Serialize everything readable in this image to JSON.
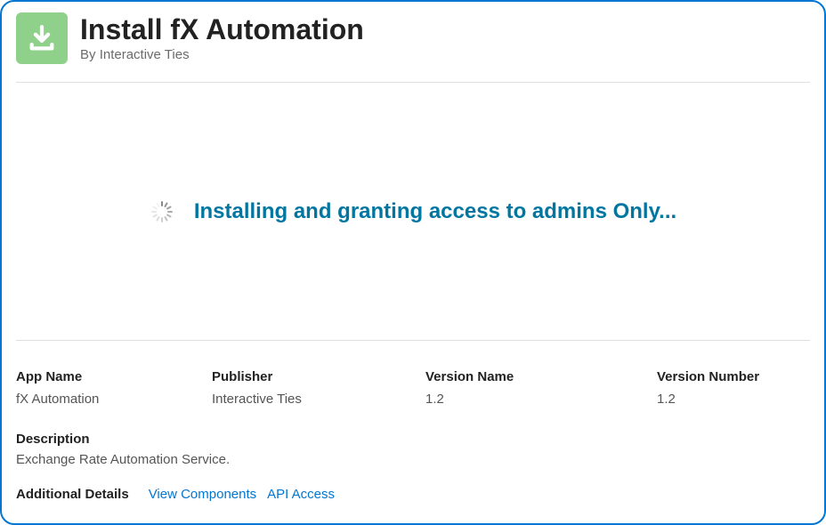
{
  "header": {
    "title": "Install fX Automation",
    "publisher_prefix": "By ",
    "publisher": "Interactive Ties"
  },
  "status": {
    "message": "Installing and granting access to admins Only..."
  },
  "details": {
    "app_name_label": "App Name",
    "app_name_value": "fX Automation",
    "publisher_label": "Publisher",
    "publisher_value": "Interactive Ties",
    "version_name_label": "Version Name",
    "version_name_value": "1.2",
    "version_number_label": "Version Number",
    "version_number_value": "1.2"
  },
  "description": {
    "label": "Description",
    "value": "Exchange Rate Automation Service."
  },
  "additional": {
    "label": "Additional Details",
    "view_components": "View Components",
    "api_access": "API Access"
  }
}
